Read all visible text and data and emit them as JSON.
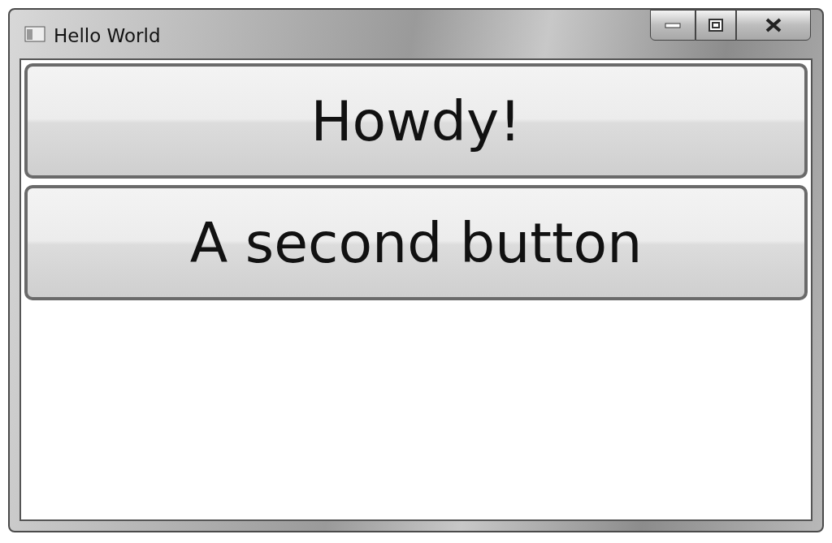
{
  "window": {
    "title": "Hello World"
  },
  "buttons": [
    {
      "label": "Howdy!"
    },
    {
      "label": "A second button"
    }
  ]
}
